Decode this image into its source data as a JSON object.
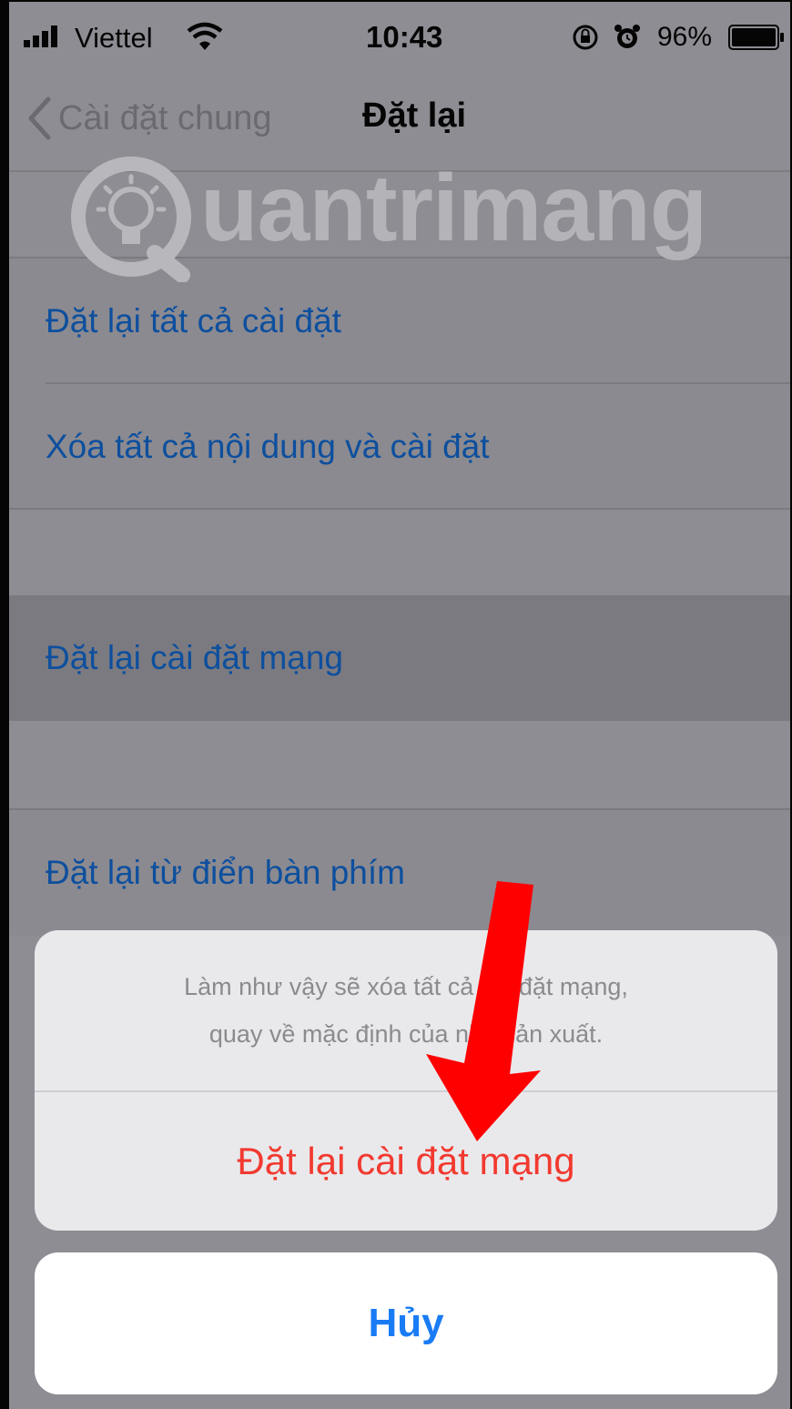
{
  "status_bar": {
    "carrier": "Viettel",
    "time": "10:43",
    "battery": "96%"
  },
  "nav": {
    "back_label": "Cài đặt chung",
    "title": "Đặt lại"
  },
  "watermark": {
    "text": "uantrimang"
  },
  "groups": [
    {
      "items": [
        {
          "label": "Đặt lại tất cả cài đặt"
        },
        {
          "label": "Xóa tất cả nội dung và cài đặt"
        }
      ]
    },
    {
      "items": [
        {
          "label": "Đặt lại cài đặt mạng",
          "highlighted": true
        }
      ]
    },
    {
      "items": [
        {
          "label": "Đặt lại từ điển bàn phím"
        }
      ]
    }
  ],
  "action_sheet": {
    "message_line1": "Làm như vậy sẽ xóa tất cả cài đặt mạng,",
    "message_line2": "quay về mặc định của nhà sản xuất.",
    "destructive_label": "Đặt lại cài đặt mạng",
    "cancel_label": "Hủy"
  },
  "colors": {
    "link_blue": "#0d4f9e",
    "destructive_red": "#f23a30",
    "cancel_blue": "#1a7cf5",
    "annotation_red": "#ff0000"
  },
  "icons": [
    "signal-icon",
    "wifi-icon",
    "lock-rotation-icon",
    "alarm-icon",
    "battery-icon",
    "chevron-left-icon",
    "lightbulb-logo-icon",
    "arrow-down-icon"
  ]
}
